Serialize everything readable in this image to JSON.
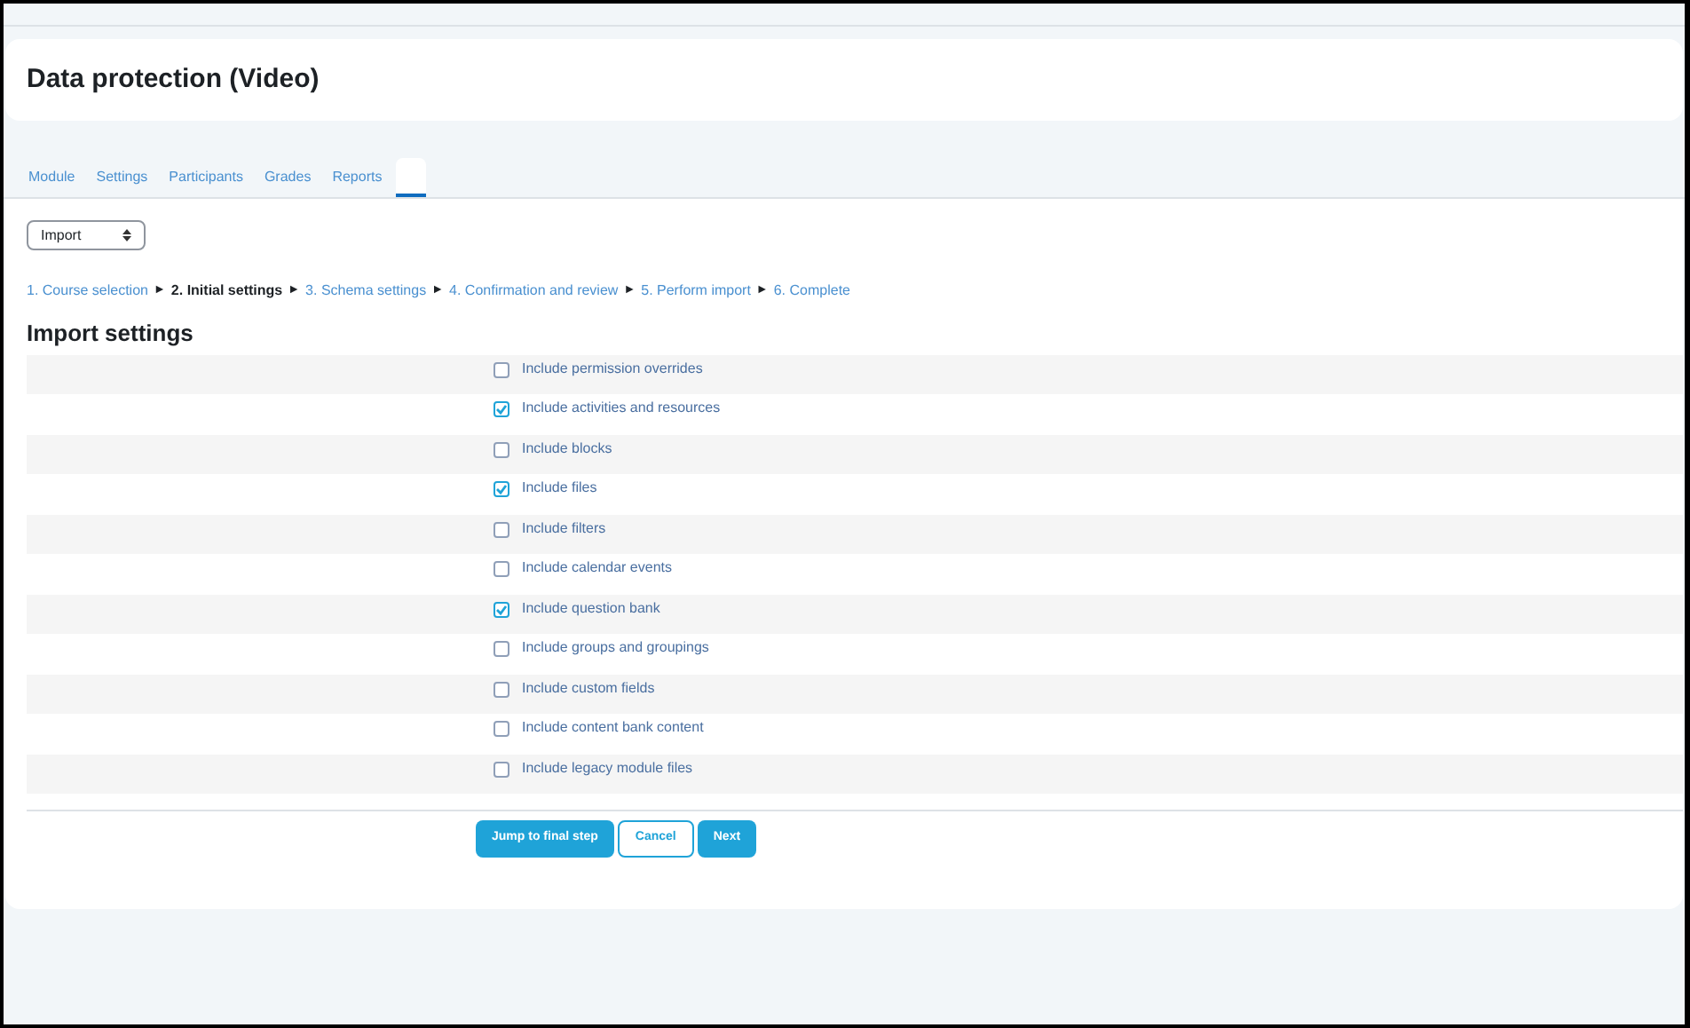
{
  "page_title": "Data protection (Video)",
  "tabs": [
    {
      "label": "Module",
      "selected": false
    },
    {
      "label": "Settings",
      "selected": false
    },
    {
      "label": "Participants",
      "selected": false
    },
    {
      "label": "Grades",
      "selected": false
    },
    {
      "label": "Reports",
      "selected": false
    },
    {
      "selected": true
    }
  ],
  "action_select": {
    "value": "Import"
  },
  "steps": [
    {
      "label": "1. Course selection",
      "current": false
    },
    {
      "label": "2. Initial settings",
      "current": true
    },
    {
      "label": "3. Schema settings",
      "current": false
    },
    {
      "label": "4. Confirmation and review",
      "current": false
    },
    {
      "label": "5. Perform import",
      "current": false
    },
    {
      "label": "6. Complete",
      "current": false
    }
  ],
  "step_separator": "►",
  "section_title": "Import settings",
  "settings": [
    {
      "label": "Include permission overrides",
      "checked": false
    },
    {
      "label": "Include activities and resources",
      "checked": true
    },
    {
      "label": "Include blocks",
      "checked": false
    },
    {
      "label": "Include files",
      "checked": true
    },
    {
      "label": "Include filters",
      "checked": false
    },
    {
      "label": "Include calendar events",
      "checked": false
    },
    {
      "label": "Include question bank",
      "checked": true
    },
    {
      "label": "Include groups and groupings",
      "checked": false
    },
    {
      "label": "Include custom fields",
      "checked": false
    },
    {
      "label": "Include content bank content",
      "checked": false
    },
    {
      "label": "Include legacy module files",
      "checked": false
    }
  ],
  "buttons": [
    {
      "label": "Jump to final step",
      "kind": "primary"
    },
    {
      "label": "Cancel",
      "kind": "secondary"
    },
    {
      "label": "Next",
      "kind": "primary"
    }
  ]
}
